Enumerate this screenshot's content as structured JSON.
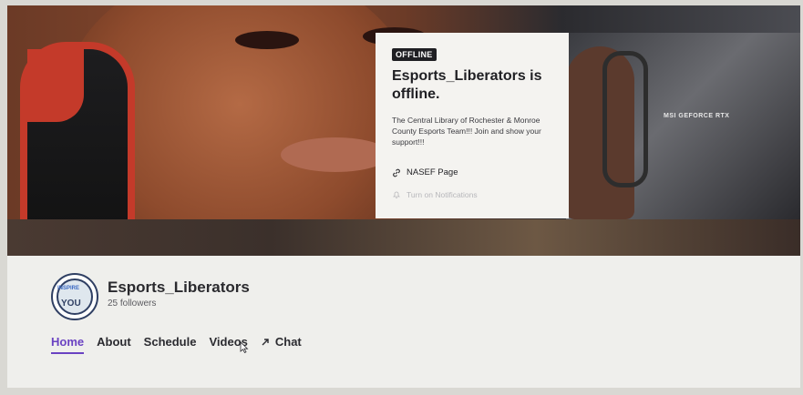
{
  "banner": {
    "gpu_label": "MSI GEFORCE RTX"
  },
  "offline_card": {
    "badge": "OFFLINE",
    "title": "Esports_Liberators is offline.",
    "description": "The Central Library of Rochester & Monroe County Esports Team!!! Join and show your support!!!",
    "link_label": "NASEF Page",
    "notify_label": "Turn on Notifications"
  },
  "channel": {
    "avatar_top": "INSPIRE",
    "avatar_text": "YOU",
    "name": "Esports_Liberators",
    "followers": "25 followers"
  },
  "tabs": [
    {
      "label": "Home",
      "active": true
    },
    {
      "label": "About"
    },
    {
      "label": "Schedule"
    },
    {
      "label": "Videos"
    },
    {
      "label": "Chat"
    }
  ],
  "colors": {
    "accent": "#6a42c2",
    "badge_bg": "#1f1f23"
  },
  "icons": {
    "external": "external-link-icon",
    "bell": "bell-icon",
    "link": "link-icon"
  }
}
